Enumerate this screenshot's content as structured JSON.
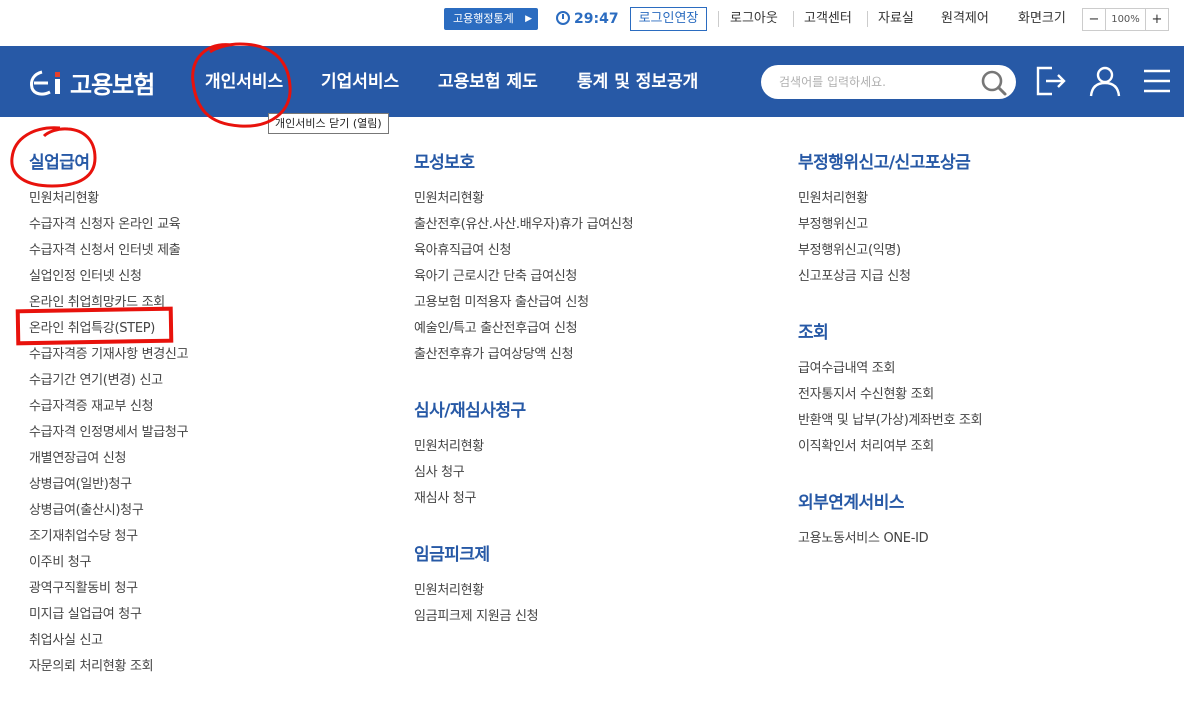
{
  "topbar": {
    "stats_label": "고용행정통계",
    "timer": "29:47",
    "extend_label": "로그인연장",
    "logout": "로그아웃",
    "customer_center": "고객센터",
    "archive": "자료실",
    "remote_control": "원격제어",
    "screen_size": "화면크기",
    "zoom_minus": "−",
    "zoom_value": "100%",
    "zoom_plus": "+"
  },
  "header": {
    "logo_text": "고용보험",
    "nav": [
      "개인서비스",
      "기업서비스",
      "고용보험 제도",
      "통계 및 정보공개"
    ],
    "search_placeholder": "검색어를 입력하세요."
  },
  "tooltip": "개인서비스 닫기 (열림)",
  "columns": {
    "left": {
      "title": "실업급여",
      "items": [
        "민원처리현황",
        "수급자격 신청자 온라인 교육",
        "수급자격 신청서 인터넷 제출",
        "실업인정 인터넷 신청",
        "온라인 취업희망카드 조회",
        "온라인 취업특강(STEP)",
        "수급자격증 기재사항 변경신고",
        "수급기간 연기(변경) 신고",
        "수급자격증 재교부 신청",
        "수급자격 인정명세서 발급청구",
        "개별연장급여 신청",
        "상병급여(일반)청구",
        "상병급여(출산시)청구",
        "조기재취업수당 청구",
        "이주비 청구",
        "광역구직활동비 청구",
        "미지급 실업급여 청구",
        "취업사실 신고",
        "자문의뢰 처리현황 조회"
      ]
    },
    "middle": [
      {
        "title": "모성보호",
        "items": [
          "민원처리현황",
          "출산전후(유산.사산.배우자)휴가 급여신청",
          "육아휴직급여 신청",
          "육아기 근로시간 단축 급여신청",
          "고용보험 미적용자 출산급여 신청",
          "예술인/특고 출산전후급여 신청",
          "출산전후휴가 급여상당액 신청"
        ]
      },
      {
        "title": "심사/재심사청구",
        "items": [
          "민원처리현황",
          "심사 청구",
          "재심사 청구"
        ]
      },
      {
        "title": "임금피크제",
        "items": [
          "민원처리현황",
          "임금피크제 지원금 신청"
        ]
      }
    ],
    "right": [
      {
        "title": "부정행위신고/신고포상금",
        "items": [
          "민원처리현황",
          "부정행위신고",
          "부정행위신고(익명)",
          "신고포상금 지급 신청"
        ]
      },
      {
        "title": "조회",
        "items": [
          "급여수급내역 조회",
          "전자통지서 수신현황 조회",
          "반환액 및 납부(가상)계좌번호 조회",
          "이직확인서 처리여부 조회"
        ]
      },
      {
        "title": "외부연계서비스",
        "items": [
          "고용노동서비스 ONE-ID"
        ]
      }
    ]
  },
  "colors": {
    "brand_blue": "#2759a6",
    "button_blue": "#2b6cc0",
    "annotation_red": "#e8120c"
  }
}
